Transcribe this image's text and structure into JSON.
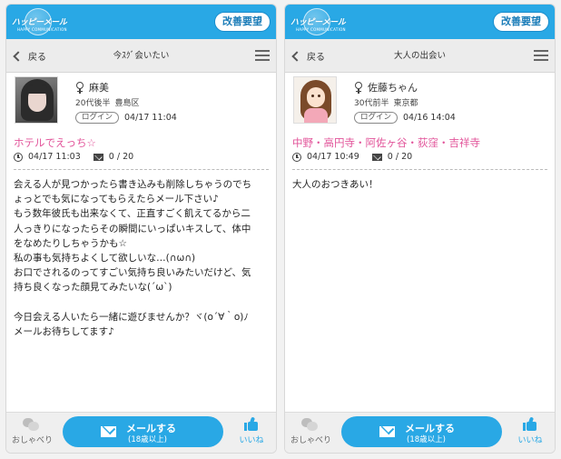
{
  "colors": {
    "accent": "#29a8e5",
    "title_pink": "#e2549a"
  },
  "panels": [
    {
      "logo_text": "ハッピーメール",
      "logo_sub": "HAPPY COMMUNICATION",
      "feedback_label": "改善要望",
      "back_label": "戻る",
      "nav_title": "今ｽｸﾞ会いたい",
      "avatar": "photo-avatar",
      "name": "麻美",
      "age": "20代後半",
      "area": "豊島区",
      "login_badge": "ログイン",
      "login_time": "04/17 11:04",
      "post_title": "ホテルでえっち☆",
      "post_time": "04/17 11:03",
      "mail_count": "0 / 20",
      "body": "会える人が見つかったら書き込みも削除しちゃうのでち\nょっとでも気になってもらえたらメール下さい♪\nもう数年彼氏も出来なくて、正直すごく飢えてるから二\n人っきりになったらその瞬間にいっぱいキスして、体中\nをなめたりしちゃうかも☆\n私の事も気持ちよくして欲しいな…(∩ω∩)\nお口でされるのってすごい気持ち良いみたいだけど、気\n持ち良くなった顔見てみたいな(´ω`)\n\n今日会える人いたら一緒に遊びませんか？ヾ(o´∀｀o)ﾉ\nメールお待ちしてます♪",
      "chat_label": "おしゃべり",
      "mail_btn_line1": "メールする",
      "mail_btn_line2": "(18歳以上)",
      "like_label": "いいね"
    },
    {
      "logo_text": "ハッピーメール",
      "logo_sub": "HAPPY COMMUNICATION",
      "feedback_label": "改善要望",
      "back_label": "戻る",
      "nav_title": "大人の出会い",
      "avatar": "illustration-avatar",
      "name": "佐藤ちゃん",
      "age": "30代前半",
      "area": "東京都",
      "login_badge": "ログイン",
      "login_time": "04/16 14:04",
      "post_title": "中野・高円寺・阿佐ヶ谷・荻窪・吉祥寺",
      "post_time": "04/17 10:49",
      "mail_count": "0 / 20",
      "body": "大人のおつきあい！",
      "chat_label": "おしゃべり",
      "mail_btn_line1": "メールする",
      "mail_btn_line2": "(18歳以上)",
      "like_label": "いいね"
    }
  ]
}
